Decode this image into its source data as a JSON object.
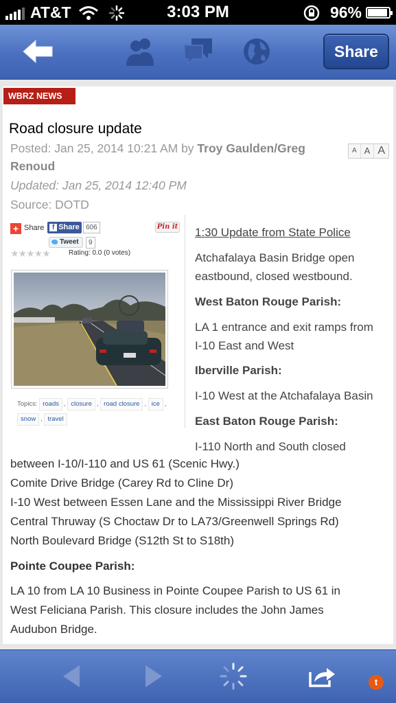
{
  "status_bar": {
    "carrier": "AT&T",
    "time": "3:03 PM",
    "battery": "96%",
    "battery_level": 0.96
  },
  "nav": {
    "share_label": "Share",
    "icons": [
      "back-arrow-icon",
      "friends-icon",
      "chat-icon",
      "globe-icon"
    ]
  },
  "article": {
    "source_badge": "WBRZ NEWS",
    "title": "Road closure update",
    "posted_prefix": "Posted: Jan 25, 2014 10:21 AM by ",
    "author_line1": "Troy Gaulden/Greg",
    "author_line2": "Renoud",
    "updated": "Updated: Jan 25, 2014 12:40 PM",
    "source": "Source: DOTD",
    "font_size_options": [
      "A",
      "A",
      "A"
    ]
  },
  "sidebar": {
    "share_label": "Share",
    "fb_share_label": "Share",
    "fb_count": "606",
    "pinit_label": "Pin it",
    "tweet_label": "Tweet",
    "tweet_count": "9",
    "rating_text": "Rating:  0.0 (0 votes)",
    "rating_value": 0.0,
    "topics_label": "Topics:",
    "topics": [
      "roads",
      "closure",
      "road closure",
      "ice",
      "snow",
      "travel"
    ]
  },
  "body": {
    "update_link": "1:30 Update from State Police",
    "p1_line1": "Atchafalaya Basin Bridge open",
    "p1_line2": "eastbound, closed westbound.",
    "h_wbr": "West Baton Rouge Parish:",
    "p2_line1": "LA 1 entrance and exit ramps from",
    "p2_line2": "I-10 East and West",
    "h_iberville": "Iberville Parish:",
    "p3": "I-10 West at the Atchafalaya Basin",
    "h_ebr": "East Baton Rouge Parish:",
    "p4_line1": "I-110 North and South closed",
    "p4_line2": "between I-10/I-110 and US 61 (Scenic Hwy.)",
    "p4_line3": "Comite Drive Bridge (Carey Rd to Cline Dr)",
    "p4_line4": "I-10 West between Essen Lane and the Mississippi River Bridge",
    "p4_line5": "Central Thruway (S Choctaw Dr to LA73/Greenwell Springs Rd)",
    "p4_line6": "North Boulevard Bridge (S12th St to S18th)",
    "h_pointe": "Pointe Coupee Parish:",
    "p5_line1": "LA 10 from LA 10 Business in Pointe Coupee Parish to US 61 in",
    "p5_line2": "West Feliciana Parish. This closure includes the John James",
    "p5_line3": "Audubon Bridge."
  },
  "toolbar": {
    "notification_badge": "t",
    "icons": [
      "back-icon",
      "forward-icon",
      "loading-spinner-icon",
      "share-out-icon"
    ]
  }
}
